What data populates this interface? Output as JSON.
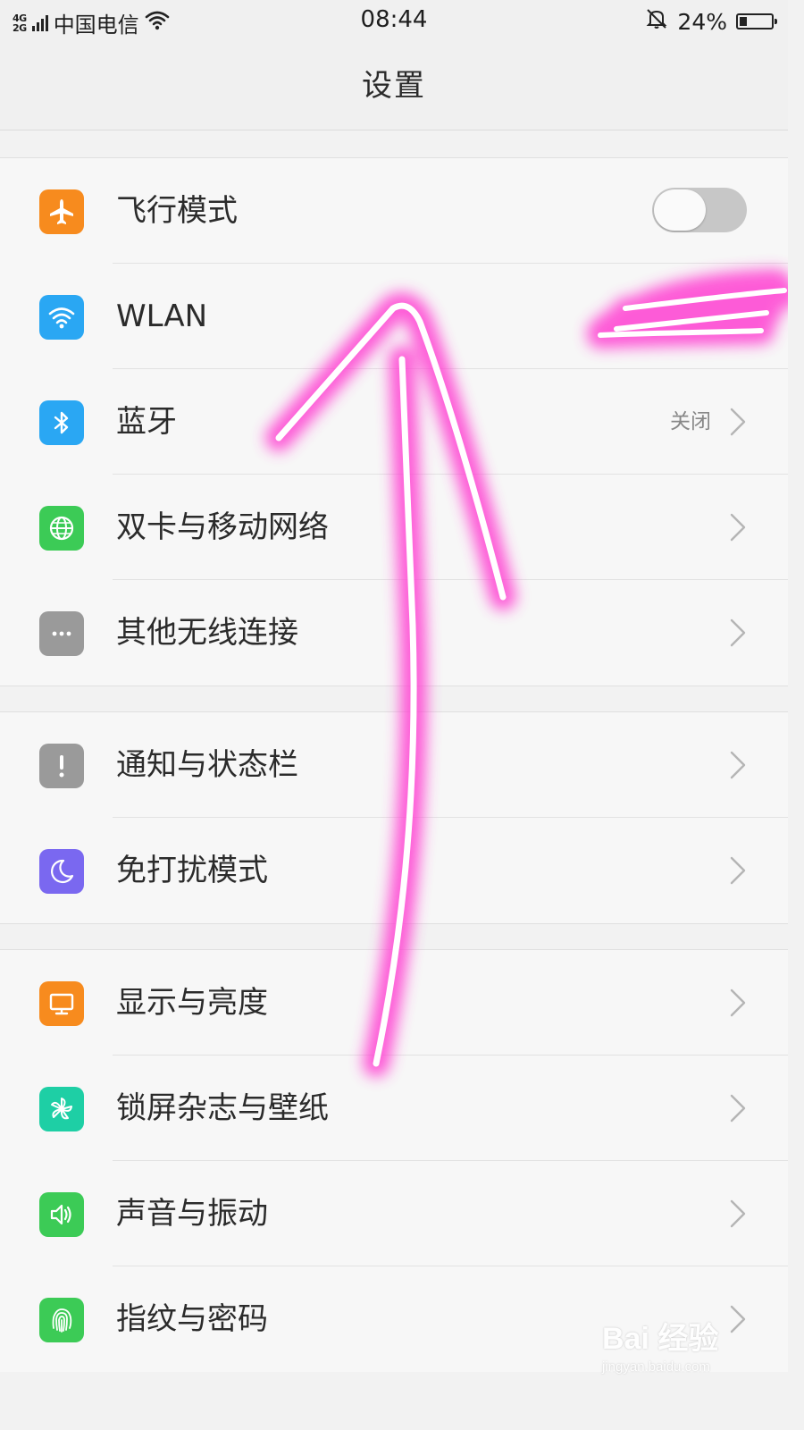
{
  "status_bar": {
    "network_top": "4G",
    "network_bottom": "2G",
    "carrier": "中国电信",
    "time": "08:44",
    "battery_percent": "24%",
    "battery_level": 0.24,
    "icons": [
      "signal-icon",
      "wifi-icon",
      "bell-muted-icon",
      "battery-icon"
    ]
  },
  "header": {
    "title": "设置"
  },
  "groups": [
    {
      "items": [
        {
          "name": "airplane-mode",
          "label": "飞行模式",
          "icon": "airplane-icon",
          "color": "#f78b1e",
          "control": "toggle",
          "toggle_on": false
        },
        {
          "name": "wlan",
          "label": "WLAN",
          "icon": "wifi-icon",
          "color": "#2aa7f3",
          "control": "none"
        },
        {
          "name": "bluetooth",
          "label": "蓝牙",
          "icon": "bluetooth-icon",
          "color": "#2aa7f3",
          "control": "chevron",
          "value": "关闭"
        },
        {
          "name": "dual-sim-mobile-network",
          "label": "双卡与移动网络",
          "icon": "globe-icon",
          "color": "#3ccb56",
          "control": "chevron"
        },
        {
          "name": "other-wireless",
          "label": "其他无线连接",
          "icon": "more-dots-icon",
          "color": "#9a9a9a",
          "control": "chevron"
        }
      ]
    },
    {
      "items": [
        {
          "name": "notification-status-bar",
          "label": "通知与状态栏",
          "icon": "exclamation-icon",
          "color": "#9a9a9a",
          "control": "chevron"
        },
        {
          "name": "do-not-disturb",
          "label": "免打扰模式",
          "icon": "moon-icon",
          "color": "#7a68f0",
          "control": "chevron"
        }
      ]
    },
    {
      "items": [
        {
          "name": "display-brightness",
          "label": "显示与亮度",
          "icon": "monitor-icon",
          "color": "#f78b1e",
          "control": "chevron"
        },
        {
          "name": "lockscreen-wallpaper",
          "label": "锁屏杂志与壁纸",
          "icon": "pinwheel-icon",
          "color": "#1ecfa5",
          "control": "chevron"
        },
        {
          "name": "sound-vibration",
          "label": "声音与振动",
          "icon": "speaker-icon",
          "color": "#3ccb56",
          "control": "chevron"
        },
        {
          "name": "fingerprint-password",
          "label": "指纹与密码",
          "icon": "fingerprint-icon",
          "color": "#3ccb56",
          "control": "chevron"
        }
      ]
    }
  ],
  "annotation": {
    "color": "#ff3fd2",
    "core_color": "#ffffff"
  },
  "watermark": {
    "logo": "Bai 经验",
    "url": "jingyan.baidu.com"
  }
}
